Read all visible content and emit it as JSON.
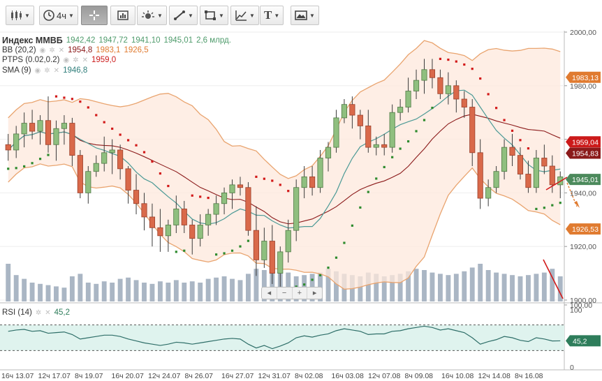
{
  "toolbar": {
    "interval_label": "4ч"
  },
  "chart": {
    "instrument": "Индекс ММВБ",
    "ohlc": [
      "1942,42",
      "1947,72",
      "1941,10",
      "1945,01"
    ],
    "volume_text": "2,6 млрд.",
    "bb": {
      "name": "BB (20,2)",
      "v1": "1954,8",
      "v2": "1983,1",
      "v3": "1926,5"
    },
    "ptps": {
      "name": "PTPS (0.02,0.2)",
      "v1": "1959,0"
    },
    "sma": {
      "name": "SMA (9)",
      "v1": "1946,8"
    },
    "rsi": {
      "name": "RSI (14)",
      "v1": "45,2"
    },
    "price_labels": [
      {
        "text": "1983,13",
        "value": 1983.13,
        "color": "#e07b30"
      },
      {
        "text": "1959,04",
        "value": 1959.04,
        "color": "#cc1a1a"
      },
      {
        "text": "1954,83",
        "value": 1954.83,
        "color": "#8b1a1a"
      },
      {
        "text": "1945,01",
        "value": 1945.01,
        "color": "#4c8a5c"
      },
      {
        "text": "1926,53",
        "value": 1926.53,
        "color": "#e07b30"
      }
    ],
    "rsi_label": {
      "text": "45,2",
      "value": 45.2,
      "color": "#2e7d5b"
    },
    "colors": {
      "up": "#8fbf7f",
      "down": "#d9694a",
      "bb_fill": "#fde8dc",
      "bb_line": "#e9a46f",
      "ma_mid": "#8b1a1a",
      "sma": "#4c9a96",
      "psar_up": "#2e8b2e",
      "psar_dn": "#d21a1a",
      "volume": "#aab6c4",
      "rsi_fill": "#dff3ee",
      "rsi_line": "#2e6e68"
    }
  },
  "chart_data": {
    "type": "candlestick",
    "ylim": [
      1900,
      2000
    ],
    "y_ticks": [
      "2000,00",
      "1980,00",
      "1960,00",
      "1940,00",
      "1920,00",
      "1900,00",
      "100,00"
    ],
    "rsi_ticks": [
      "100",
      "0"
    ],
    "x_ticks": [
      "16ч 13.07",
      "12ч 17.07",
      "8ч 19.07",
      "16ч 20.07",
      "12ч 24.07",
      "8ч 26.07",
      "16ч 27.07",
      "12ч 31.07",
      "8ч 02.08",
      "16ч 03.08",
      "12ч 07.08",
      "8ч 09.08",
      "16ч 10.08",
      "12ч 14.08",
      "8ч 16.08"
    ],
    "candles": [
      [
        1958,
        1962,
        1952,
        1956
      ],
      [
        1956,
        1965,
        1953,
        1962
      ],
      [
        1962,
        1970,
        1957,
        1966
      ],
      [
        1966,
        1971,
        1960,
        1963
      ],
      [
        1963,
        1969,
        1958,
        1967
      ],
      [
        1967,
        1976,
        1955,
        1958
      ],
      [
        1958,
        1967,
        1952,
        1964
      ],
      [
        1964,
        1969,
        1958,
        1966
      ],
      [
        1966,
        1968,
        1950,
        1954
      ],
      [
        1954,
        1956,
        1938,
        1940
      ],
      [
        1940,
        1950,
        1936,
        1948
      ],
      [
        1948,
        1954,
        1946,
        1951
      ],
      [
        1951,
        1961,
        1948,
        1955
      ],
      [
        1955,
        1960,
        1947,
        1956
      ],
      [
        1956,
        1958,
        1945,
        1949
      ],
      [
        1949,
        1950,
        1936,
        1941
      ],
      [
        1941,
        1947,
        1932,
        1936
      ],
      [
        1936,
        1940,
        1926,
        1931
      ],
      [
        1931,
        1936,
        1920,
        1927
      ],
      [
        1927,
        1934,
        1918,
        1924
      ],
      [
        1924,
        1930,
        1918,
        1928
      ],
      [
        1928,
        1939,
        1925,
        1934
      ],
      [
        1934,
        1937,
        1925,
        1928
      ],
      [
        1928,
        1930,
        1917,
        1923
      ],
      [
        1923,
        1932,
        1920,
        1928
      ],
      [
        1928,
        1934,
        1924,
        1932
      ],
      [
        1932,
        1939,
        1928,
        1936
      ],
      [
        1936,
        1942,
        1932,
        1940
      ],
      [
        1940,
        1945,
        1934,
        1943
      ],
      [
        1943,
        1946,
        1939,
        1942
      ],
      [
        1942,
        1944,
        1924,
        1926
      ],
      [
        1926,
        1935,
        1909,
        1915
      ],
      [
        1915,
        1927,
        1912,
        1922
      ],
      [
        1922,
        1928,
        1906,
        1910
      ],
      [
        1910,
        1920,
        1905,
        1918
      ],
      [
        1918,
        1930,
        1914,
        1926
      ],
      [
        1926,
        1945,
        1922,
        1942
      ],
      [
        1942,
        1950,
        1938,
        1946
      ],
      [
        1946,
        1950,
        1939,
        1942
      ],
      [
        1942,
        1956,
        1940,
        1953
      ],
      [
        1953,
        1959,
        1948,
        1957
      ],
      [
        1957,
        1971,
        1955,
        1968
      ],
      [
        1968,
        1975,
        1966,
        1973
      ],
      [
        1973,
        1976,
        1964,
        1969
      ],
      [
        1969,
        1971,
        1960,
        1965
      ],
      [
        1965,
        1971,
        1955,
        1957
      ],
      [
        1957,
        1961,
        1954,
        1958
      ],
      [
        1958,
        1962,
        1954,
        1957
      ],
      [
        1957,
        1973,
        1955,
        1970
      ],
      [
        1970,
        1975,
        1967,
        1972
      ],
      [
        1972,
        1983,
        1970,
        1978
      ],
      [
        1978,
        1986,
        1975,
        1982
      ],
      [
        1982,
        1990,
        1977,
        1986
      ],
      [
        1986,
        1990,
        1979,
        1983
      ],
      [
        1983,
        1986,
        1975,
        1977
      ],
      [
        1977,
        1985,
        1973,
        1980
      ],
      [
        1980,
        1982,
        1970,
        1975
      ],
      [
        1975,
        1978,
        1968,
        1972
      ],
      [
        1972,
        1975,
        1950,
        1955
      ],
      [
        1955,
        1960,
        1934,
        1938
      ],
      [
        1938,
        1945,
        1935,
        1942
      ],
      [
        1942,
        1950,
        1940,
        1948
      ],
      [
        1948,
        1960,
        1945,
        1957
      ],
      [
        1957,
        1962,
        1950,
        1954
      ],
      [
        1954,
        1957,
        1945,
        1947
      ],
      [
        1947,
        1952,
        1940,
        1942
      ],
      [
        1942,
        1956,
        1940,
        1953
      ],
      [
        1953,
        1958,
        1947,
        1950
      ],
      [
        1950,
        1954,
        1940,
        1943
      ],
      [
        1943,
        1948,
        1938,
        1946
      ]
    ],
    "volume": [
      60,
      42,
      36,
      30,
      28,
      26,
      24,
      22,
      40,
      44,
      30,
      28,
      32,
      30,
      36,
      38,
      34,
      30,
      28,
      32,
      30,
      34,
      30,
      32,
      30,
      36,
      38,
      40,
      36,
      34,
      44,
      52,
      50,
      58,
      56,
      46,
      40,
      42,
      44,
      46,
      52,
      48,
      44,
      42,
      40,
      46,
      44,
      40,
      42,
      44,
      48,
      52,
      50,
      46,
      44,
      42,
      44,
      48,
      54,
      60,
      50,
      46,
      44,
      42,
      40,
      42,
      44,
      46,
      52,
      40
    ],
    "rsi": [
      60,
      62,
      63,
      60,
      61,
      57,
      58,
      59,
      55,
      48,
      50,
      52,
      54,
      54,
      52,
      48,
      45,
      42,
      40,
      38,
      40,
      43,
      42,
      40,
      42,
      44,
      46,
      48,
      49,
      48,
      40,
      34,
      38,
      33,
      37,
      42,
      50,
      53,
      51,
      54,
      56,
      61,
      64,
      62,
      60,
      55,
      56,
      56,
      60,
      61,
      64,
      66,
      68,
      66,
      62,
      64,
      61,
      58,
      50,
      40,
      44,
      47,
      52,
      50,
      46,
      44,
      50,
      48,
      45,
      45.2
    ]
  }
}
